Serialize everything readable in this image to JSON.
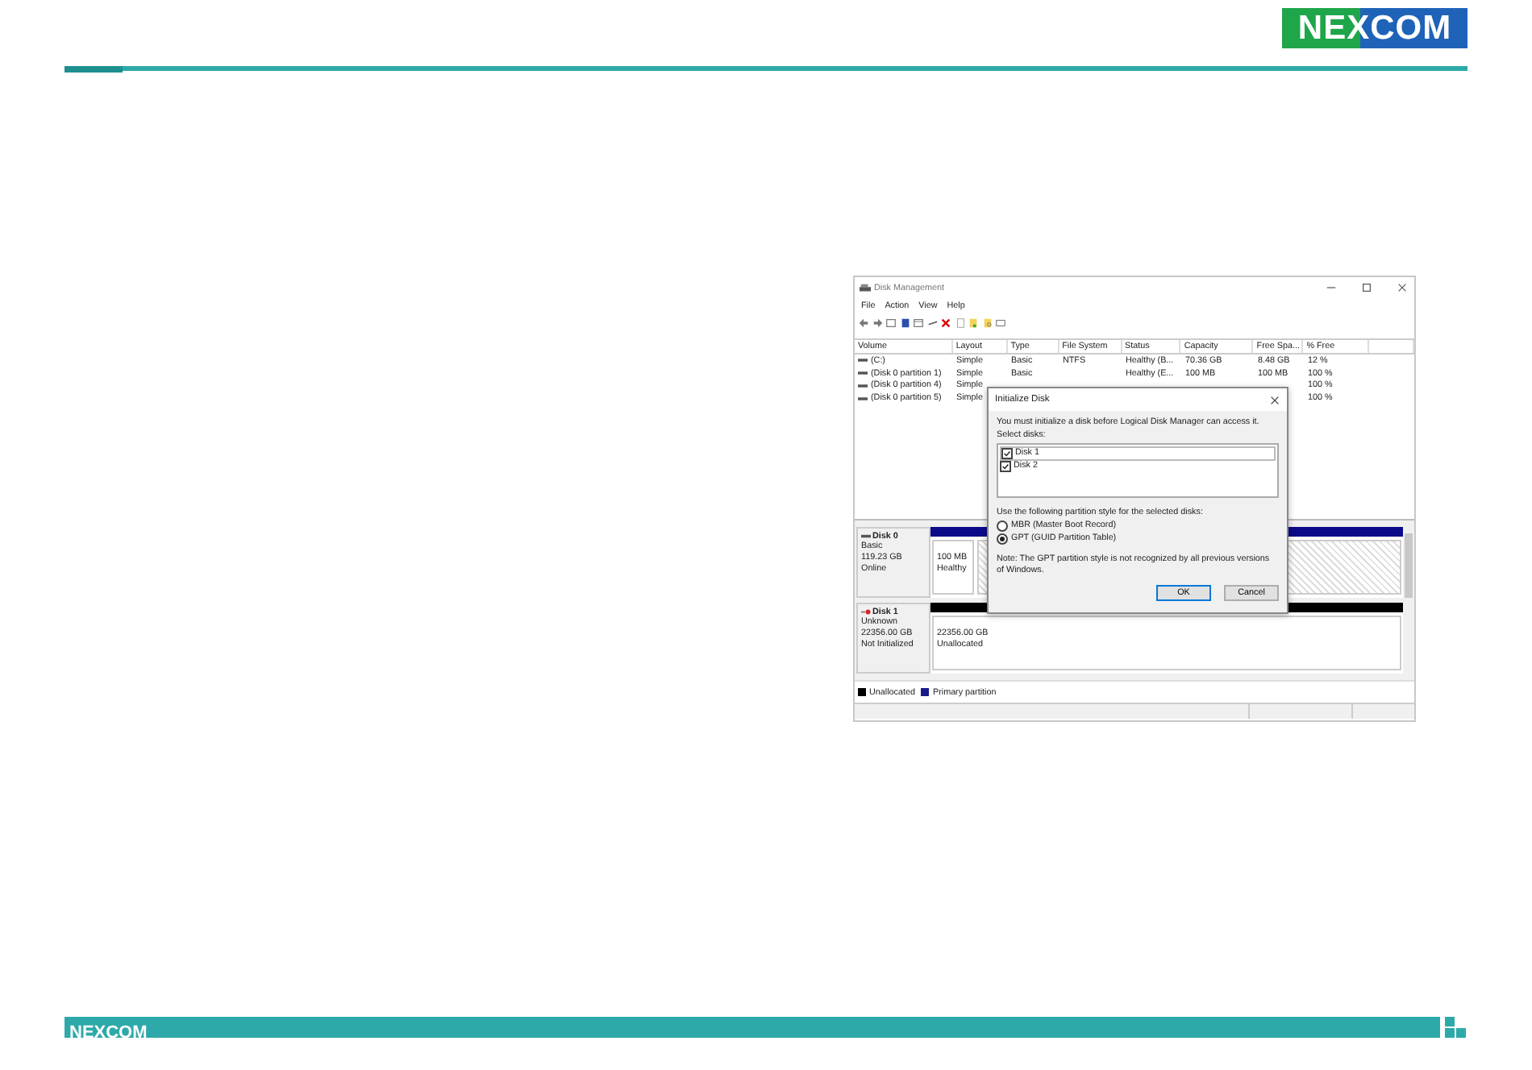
{
  "header": {
    "logo": "NEXCOM"
  },
  "window": {
    "title": "Disk Management",
    "menu": [
      "File",
      "Action",
      "View",
      "Help"
    ],
    "table": {
      "columns": [
        "Volume",
        "Layout",
        "Type",
        "File System",
        "Status",
        "Capacity",
        "Free Spa...",
        "% Free"
      ],
      "rows": [
        {
          "cells": [
            "(C:)",
            "Simple",
            "Basic",
            "NTFS",
            "Healthy (B...",
            "70.36 GB",
            "8.48 GB",
            "12 %"
          ]
        },
        {
          "cells": [
            "(Disk 0 partition 1)",
            "Simple",
            "Basic",
            null,
            "Healthy (E...",
            "100 MB",
            "100 MB",
            "100 %"
          ]
        },
        {
          "cells": [
            "(Disk 0 partition 4)",
            "Simple",
            null,
            null,
            null,
            null,
            null,
            "100 %"
          ]
        },
        {
          "cells": [
            "(Disk 0 partition 5)",
            "Simple",
            null,
            null,
            null,
            null,
            null,
            "100 %"
          ]
        }
      ]
    },
    "disks": [
      {
        "name": "Disk 0",
        "kind": "online",
        "type": "Basic",
        "size": "119.23 GB",
        "state": "Online",
        "partitions": [
          {
            "size": "100 MB",
            "status": "Healthy",
            "kind": "primary"
          }
        ]
      },
      {
        "name": "Disk 1",
        "kind": "uninitialized",
        "type": "Unknown",
        "size": "22356.00 GB",
        "state": "Not Initialized",
        "partitions": [
          {
            "size": "22356.00 GB",
            "status": "Unallocated",
            "kind": "unallocated"
          }
        ]
      }
    ],
    "legend": [
      {
        "label": "Unallocated",
        "color": "#000000"
      },
      {
        "label": "Primary partition",
        "color": "#1a1a8c"
      }
    ]
  },
  "dialog": {
    "title": "Initialize Disk",
    "message": "You must initialize a disk before Logical Disk Manager can access it.",
    "select_label": "Select disks:",
    "disks": [
      {
        "label": "Disk 1",
        "checked": true
      },
      {
        "label": "Disk 2",
        "checked": true
      }
    ],
    "style_label": "Use the following partition style for the selected disks:",
    "styles": [
      {
        "label": "MBR (Master Boot Record)",
        "selected": false
      },
      {
        "label": "GPT (GUID Partition Table)",
        "selected": true
      }
    ],
    "note": "Note:  The GPT partition style is not recognized by all previous versions of Windows.",
    "buttons": [
      "OK",
      "Cancel"
    ]
  },
  "footer": {
    "logo": "NEXCOM"
  }
}
